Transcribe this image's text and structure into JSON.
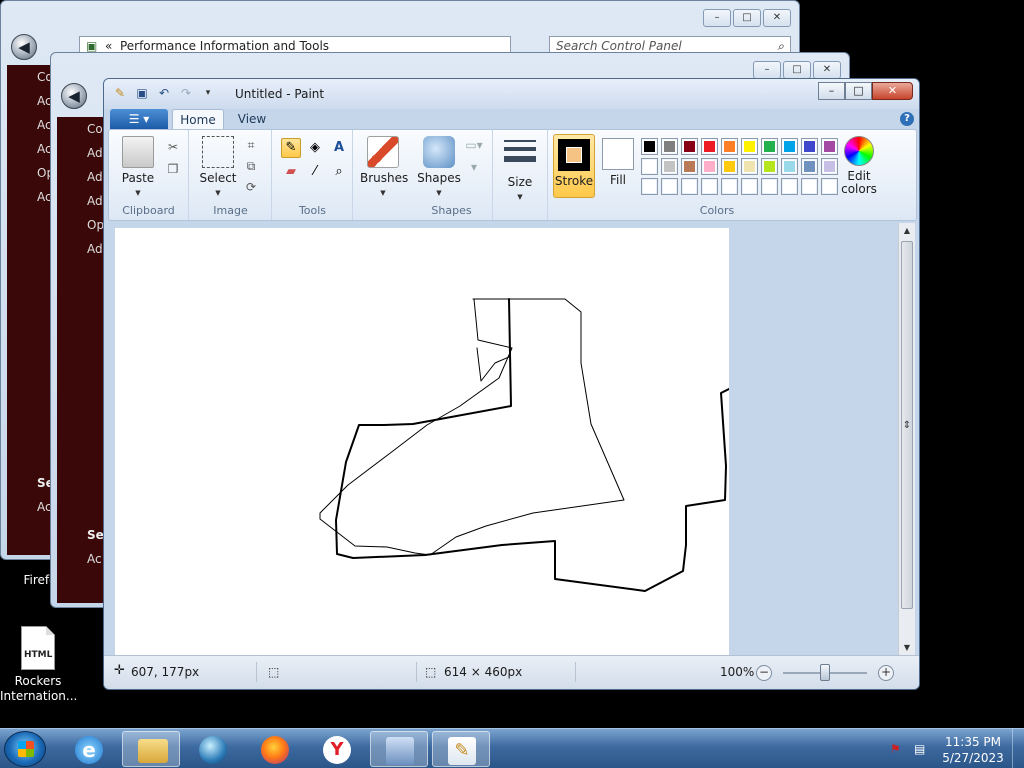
{
  "desktop": {
    "firefox_label": "Firefo",
    "html_file": {
      "badge": "HTML",
      "line1": "Rockers",
      "line2": "Internation..."
    }
  },
  "bg_window_1": {
    "address": "Performance Information and Tools",
    "search_placeholder": "Search Control Panel",
    "side_items": [
      "Co",
      "Ac",
      "Ac",
      "Ac",
      "Op",
      "Ac"
    ],
    "see_also": "Se",
    "see_also_item": "Ac"
  },
  "bg_window_2": {
    "side_items": [
      "Co",
      "Ad",
      "Ad",
      "Ad",
      "Op",
      "Ad"
    ],
    "see_also": "Se",
    "see_also_item": "Ac"
  },
  "paint": {
    "title": "Untitled - Paint",
    "window_buttons": {
      "minimize": "–",
      "maximize": "□",
      "close": "✕"
    },
    "tabs": [
      "Home",
      "View"
    ],
    "groups": {
      "clipboard": {
        "label": "Clipboard",
        "paste": "Paste"
      },
      "image": {
        "label": "Image",
        "select": "Select"
      },
      "tools": {
        "label": "Tools"
      },
      "shapes": {
        "label": "Shapes",
        "brushes": "Brushes",
        "shapes": "Shapes"
      },
      "size": {
        "label": "Size"
      },
      "colors": {
        "label": "Colors",
        "stroke": "Stroke",
        "fill": "Fill",
        "edit_colors_1": "Edit",
        "edit_colors_2": "colors"
      }
    },
    "palette_row1": [
      "#000000",
      "#7f7f7f",
      "#880015",
      "#ed1c24",
      "#ff7f27",
      "#fff200",
      "#22b14c",
      "#00a2e8",
      "#3f48cc",
      "#a349a4"
    ],
    "palette_row2": [
      "#ffffff",
      "#c3c3c3",
      "#b97a57",
      "#ffaec9",
      "#ffc90e",
      "#efe4b0",
      "#b5e61d",
      "#99d9ea",
      "#7092be",
      "#c8bfe7"
    ],
    "palette_row3": [
      "#ffffff",
      "#ffffff",
      "#ffffff",
      "#ffffff",
      "#ffffff",
      "#ffffff",
      "#ffffff",
      "#ffffff",
      "#ffffff",
      "#ffffff"
    ],
    "status": {
      "cursor_pos": "607, 177px",
      "canvas_size": "614 × 460px",
      "zoom": "100%"
    }
  },
  "taskbar": {
    "time": "11:35 PM",
    "date": "5/27/2023"
  }
}
